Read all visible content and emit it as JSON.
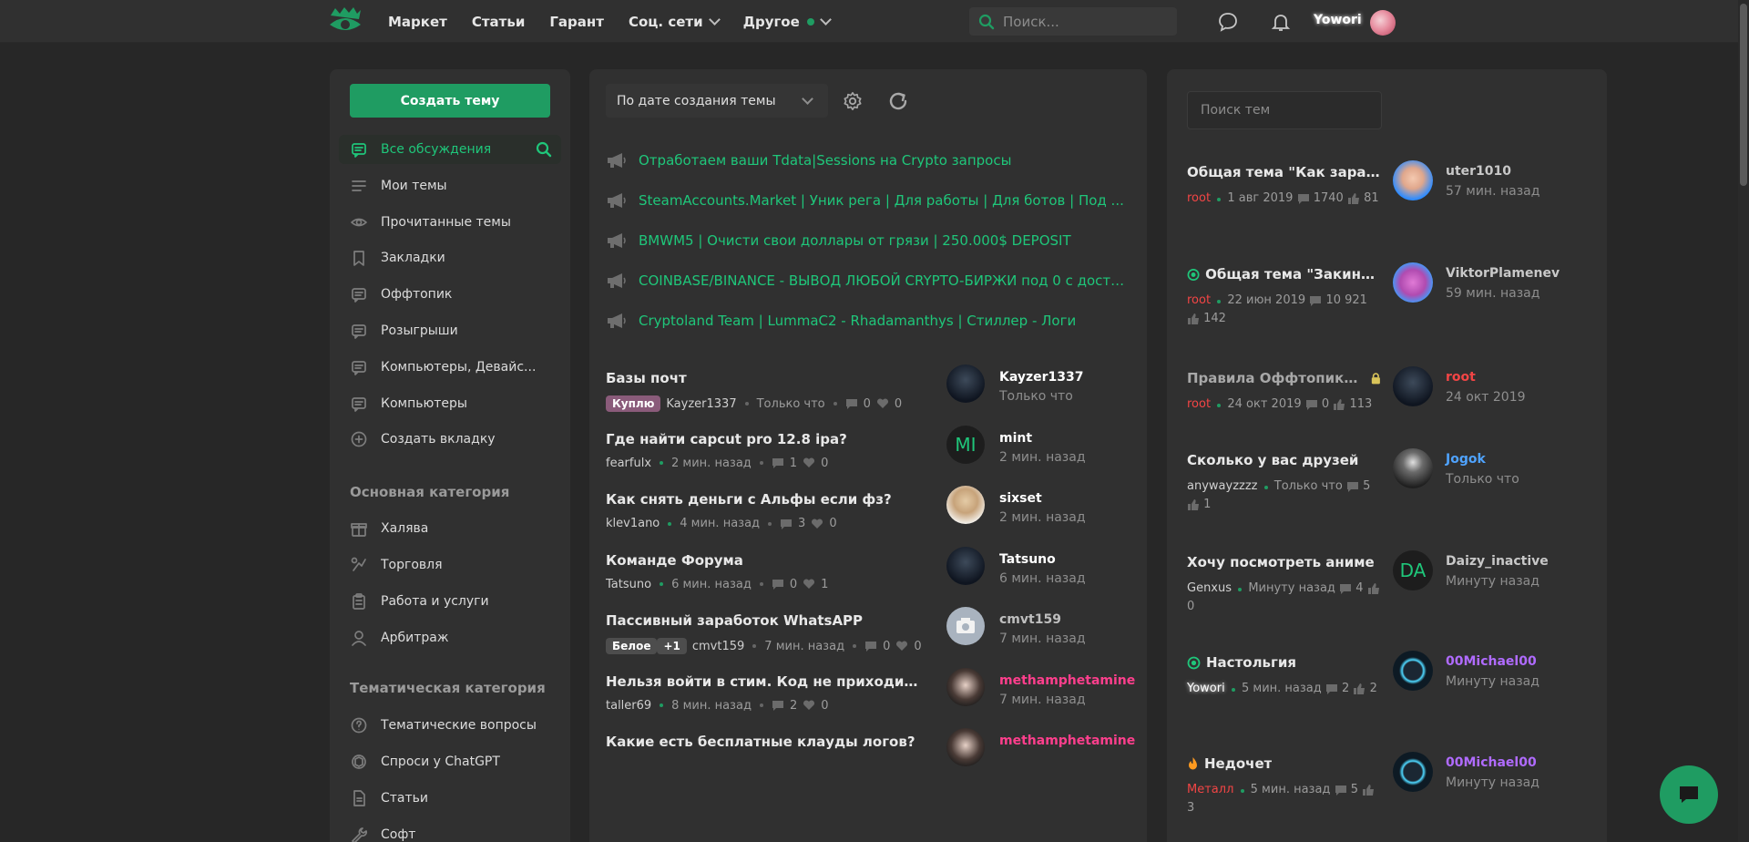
{
  "topbar": {
    "nav": [
      {
        "label": "Маркет",
        "chevron": false,
        "dot": false
      },
      {
        "label": "Статьи",
        "chevron": false,
        "dot": false
      },
      {
        "label": "Гарант",
        "chevron": false,
        "dot": false
      },
      {
        "label": "Соц. сети",
        "chevron": true,
        "dot": false
      },
      {
        "label": "Другое",
        "chevron": true,
        "dot": true
      }
    ],
    "search_placeholder": "Поиск...",
    "username": "Yowori"
  },
  "sidebar": {
    "create_button": "Создать тему",
    "items": [
      {
        "label": "Все обсуждения",
        "icon": "chat-icon",
        "active": true
      },
      {
        "label": "Мои темы",
        "icon": "list-icon"
      },
      {
        "label": "Прочитанные темы",
        "icon": "eye-icon"
      },
      {
        "label": "Закладки",
        "icon": "bookmark-icon"
      },
      {
        "label": "Оффтопик",
        "icon": "chat-icon"
      },
      {
        "label": "Розыгрыши",
        "icon": "chat-icon"
      },
      {
        "label": "Компьютеры, Девайс...",
        "icon": "chat-icon"
      },
      {
        "label": "Компьютеры",
        "icon": "chat-icon"
      },
      {
        "label": "Создать вкладку",
        "icon": "plus-circle-icon"
      }
    ],
    "section1_title": "Основная категория",
    "section1": [
      {
        "label": "Халява",
        "icon": "gift-icon"
      },
      {
        "label": "Торговля",
        "icon": "trade-icon"
      },
      {
        "label": "Работа и услуги",
        "icon": "clipboard-icon"
      },
      {
        "label": "Арбитраж",
        "icon": "user-icon"
      }
    ],
    "section2_title": "Тематическая категория",
    "section2": [
      {
        "label": "Тематические вопросы",
        "icon": "question-icon"
      },
      {
        "label": "Спроси у ChatGPT",
        "icon": "chatgpt-icon"
      },
      {
        "label": "Статьи",
        "icon": "document-icon"
      },
      {
        "label": "Софт",
        "icon": "wrench-icon"
      }
    ]
  },
  "main": {
    "sort_label": "По дате создания темы",
    "pinned": [
      "Отработаем ваши Tdata|Sessions на Crypto запросы",
      "SteamAccounts.Market | Уник рега | Для работы | Для ботов | Под ...",
      "BMWM5 | Очисти свои доллары от грязи | 250.000$ DEPOSIT",
      "COINBASE/BINANCE - ВЫВОД ЛЮБОЙ CRYPTO-БИРЖИ под 0 с досту...",
      "Cryptoland Team | LummaC2 - Rhadamanthys | Стиллер - Логи"
    ],
    "topics": [
      {
        "title": "Базы почт",
        "badge": "Куплю",
        "badge_type": "kuplyu",
        "author": "Kayzer1337",
        "time": "Только что",
        "replies": "0",
        "likes": "0",
        "last_user": "Kayzer1337",
        "last_time": "Только что",
        "last_color": "#ffffff",
        "avatar": "dark"
      },
      {
        "title": "Где найти capcut pro 12.8 ipa?",
        "badge": "",
        "author": "fearfulx",
        "time": "2 мин. назад",
        "replies": "1",
        "likes": "0",
        "last_user": "mint",
        "last_time": "2 мин. назад",
        "last_color": "#ffffff",
        "avatar": "MI"
      },
      {
        "title": "Как снять деньги с Альфы если фз?",
        "badge": "",
        "author": "klev1ano",
        "time": "4 мин. назад",
        "replies": "3",
        "likes": "0",
        "last_user": "sixset",
        "last_time": "2 мин. назад",
        "last_color": "#ffffff",
        "avatar": "light"
      },
      {
        "title": "Команде Форума",
        "badge": "",
        "author": "Tatsuno",
        "time": "6 мин. назад",
        "replies": "0",
        "likes": "1",
        "last_user": "Tatsuno",
        "last_time": "6 мин. назад",
        "last_color": "#ffffff",
        "avatar": "dark"
      },
      {
        "title": "Пассивный заработок WhatsAPP",
        "badge": "Белое",
        "badge_extra": "+1",
        "badge_type": "beloe",
        "author": "cmvt159",
        "time": "7 мин. назад",
        "replies": "0",
        "likes": "0",
        "last_user": "cmvt159",
        "last_time": "7 мин. назад",
        "last_color": "#bfbfbf",
        "avatar": "camera"
      },
      {
        "title": "Нельзя войти в стим. Код не приходит на ...",
        "badge": "",
        "author": "taller69",
        "time": "8 мин. назад",
        "replies": "2",
        "likes": "0",
        "last_user": "methamphetamine",
        "last_time": "7 мин. назад",
        "last_color": "#ff3f8d",
        "avatar": "girl"
      },
      {
        "title": "Какие есть бесплатные клауды логов?",
        "badge": "",
        "author": "",
        "time": "",
        "replies": "",
        "likes": "",
        "last_user": "methamphetamine",
        "last_time": "",
        "last_color": "#ff3f8d",
        "avatar": "girl"
      }
    ]
  },
  "right": {
    "search_placeholder": "Поиск тем",
    "topics": [
      {
        "title": "Общая тема \"Как зарабо...",
        "prefix_icon": "",
        "author": "root",
        "author_class": "red",
        "date": "1 авг 2019",
        "replies": "1740",
        "likes": "81",
        "user": "uter1010",
        "user_class": "",
        "time": "57 мин. назад",
        "avatar": "blue"
      },
      {
        "title": "Общая тема \"Закиньт...",
        "prefix_icon": "target",
        "author": "root",
        "author_class": "red",
        "date": "22 июн 2019",
        "replies": "10 921",
        "likes": "142",
        "user": "ViktorPlamenev",
        "user_class": "",
        "time": "59 мин. назад",
        "avatar": "cartoon"
      },
      {
        "title": "Правила Оффтопика и...",
        "prefix_icon": "",
        "locked": true,
        "author": "root",
        "author_class": "red",
        "date": "24 окт 2019",
        "replies": "0",
        "likes": "113",
        "user": "root",
        "user_class": "red",
        "time": "24 окт 2019",
        "avatar": "dark"
      },
      {
        "title": "Сколько у вас друзей",
        "prefix_icon": "",
        "author": "anywayzzzz",
        "author_class": "",
        "date": "Только что",
        "replies": "5",
        "likes": "1",
        "user": "Jogok",
        "user_class": "blue",
        "time": "Только что",
        "avatar": "dark2"
      },
      {
        "title": "Хочу посмотреть аниме",
        "prefix_icon": "",
        "author": "Genxus",
        "author_class": "",
        "date": "Минуту назад",
        "replies": "4",
        "likes": "0",
        "user": "Daizy_inactive",
        "user_class": "",
        "time": "Минуту назад",
        "avatar": "DA"
      },
      {
        "title": "Настольгия",
        "prefix_icon": "target",
        "author": "Yowori",
        "author_class": "glow",
        "date": "5 мин. назад",
        "replies": "2",
        "likes": "2",
        "user": "00Michael00",
        "user_class": "purple",
        "time": "Минуту назад",
        "avatar": "ring"
      },
      {
        "title": "Недочет",
        "prefix_icon": "fire",
        "author": "Металл",
        "author_class": "red",
        "date": "5 мин. назад",
        "replies": "5",
        "likes": "3",
        "user": "00Michael00",
        "user_class": "purple",
        "time": "Минуту назад",
        "avatar": "ring"
      }
    ]
  },
  "colors": {
    "accent": "#1f9c62",
    "accent_text": "#1fc67a",
    "background": "#272727",
    "panel": "#303030"
  }
}
